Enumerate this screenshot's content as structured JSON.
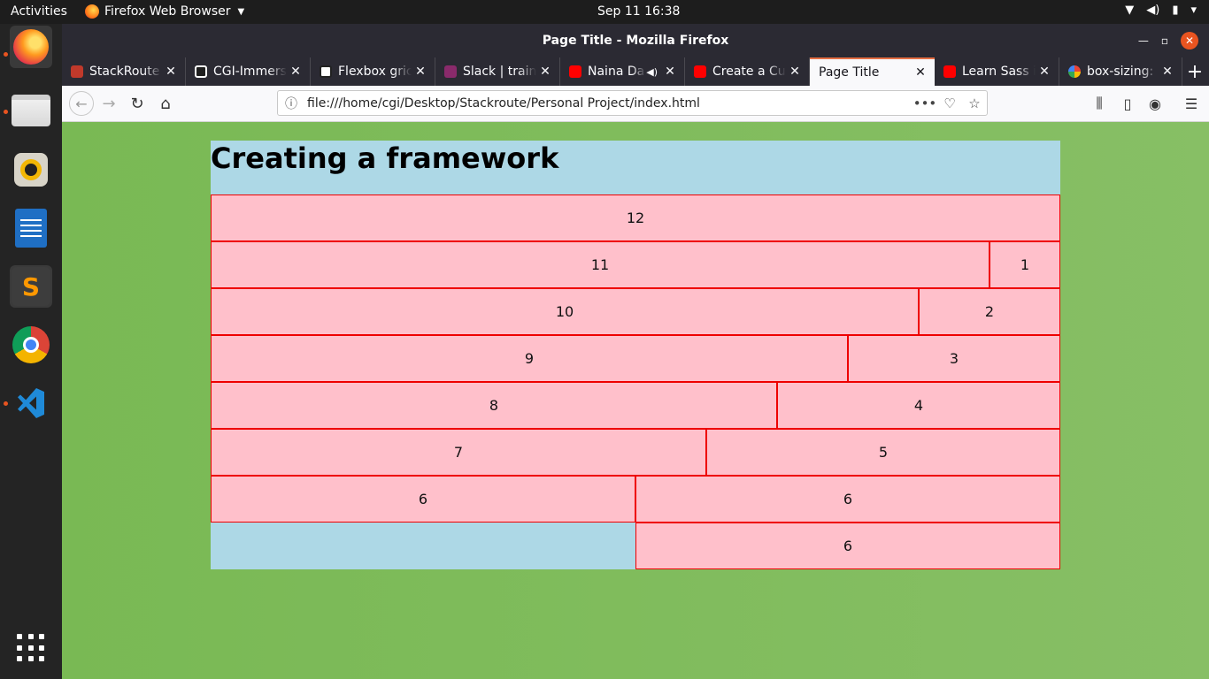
{
  "topbar": {
    "activities": "Activities",
    "app_name": "Firefox Web Browser",
    "clock": "Sep 11  16:38",
    "icons": [
      "wifi-icon",
      "volume-icon",
      "battery-icon",
      "power-menu-icon"
    ]
  },
  "dock": {
    "items": [
      "Firefox",
      "Files",
      "Rhythmbox",
      "LibreOffice Writer",
      "Sublime Text",
      "Google Chrome",
      "Visual Studio Code"
    ],
    "show_apps_icon": "apps-grid-icon"
  },
  "window": {
    "title": "Page Title - Mozilla Firefox"
  },
  "tabs": [
    {
      "label": "StackRoute",
      "favicon_color": "#c0392b"
    },
    {
      "label": "CGI-Immersi",
      "favicon_color": "#1e1e1e"
    },
    {
      "label": "Flexbox gric",
      "favicon_color": "#ffffff"
    },
    {
      "label": "Slack | traini",
      "favicon_color": "#8a2a6b"
    },
    {
      "label": "Naina Da",
      "favicon_color": "#ff0000",
      "audio": true
    },
    {
      "label": "Create a Cus",
      "favicon_color": "#ff0000"
    },
    {
      "label": "Page Title",
      "selected": true
    },
    {
      "label": "Learn Sass i",
      "favicon_color": "#ff0000"
    },
    {
      "label": "box-sizing: i",
      "favicon_color": "#4285f4"
    }
  ],
  "navbar": {
    "url": "file:///home/cgi/Desktop/Stackroute/Personal Project/index.html"
  },
  "page": {
    "heading": "Creating a framework",
    "rows": [
      [
        "12"
      ],
      [
        "11",
        "1"
      ],
      [
        "10",
        "2"
      ],
      [
        "9",
        "3"
      ],
      [
        "8",
        "4"
      ],
      [
        "7",
        "5"
      ],
      [
        "6",
        "6"
      ],
      [
        "6"
      ]
    ]
  },
  "colors": {
    "page_bg": "#79b954",
    "heading_bg": "#add8e6",
    "cell_bg": "#ffc0cb",
    "cell_border": "#ee0000",
    "tab_accent": "#e66f44"
  }
}
